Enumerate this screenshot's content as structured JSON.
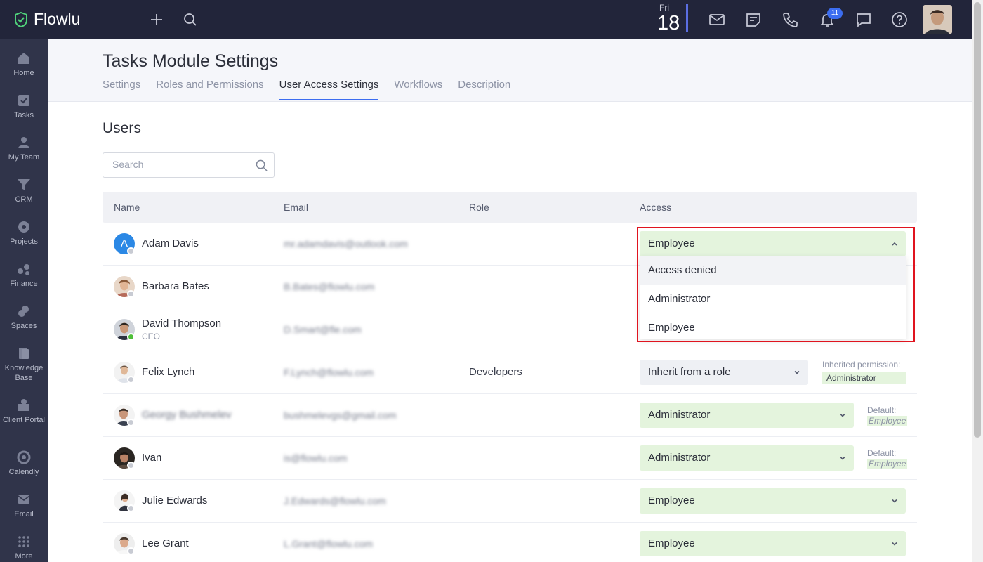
{
  "app": {
    "name": "Flowlu"
  },
  "topbar": {
    "date_dow": "Fri",
    "date_day": "18",
    "notifications_count": "11"
  },
  "sidebar": {
    "items": [
      {
        "label": "Home",
        "icon": "home-icon"
      },
      {
        "label": "Tasks",
        "icon": "tasks-icon"
      },
      {
        "label": "My Team",
        "icon": "team-icon"
      },
      {
        "label": "CRM",
        "icon": "crm-icon"
      },
      {
        "label": "Projects",
        "icon": "projects-icon"
      },
      {
        "label": "Finance",
        "icon": "finance-icon"
      },
      {
        "label": "Spaces",
        "icon": "spaces-icon"
      },
      {
        "label": "Knowledge Base",
        "icon": "knowledge-base-icon"
      },
      {
        "label": "Client Portal",
        "icon": "client-portal-icon"
      },
      {
        "label": "Calendly",
        "icon": "calendly-icon"
      },
      {
        "label": "Email",
        "icon": "email-icon"
      },
      {
        "label": "More",
        "icon": "more-icon"
      }
    ]
  },
  "page": {
    "title": "Tasks Module Settings",
    "tabs": [
      "Settings",
      "Roles and Permissions",
      "User Access Settings",
      "Workflows",
      "Description"
    ],
    "active_tab": "User Access Settings",
    "section_title": "Users",
    "search_placeholder": "Search"
  },
  "table": {
    "headers": {
      "name": "Name",
      "email": "Email",
      "role": "Role",
      "access": "Access"
    },
    "rows": [
      {
        "name": "Adam Davis",
        "sub": "",
        "email": "mr.adamdavis@outlook.com",
        "role": "",
        "access": "Employee"
      },
      {
        "name": "Barbara Bates",
        "sub": "",
        "email": "B.Bates@flowlu.com",
        "role": "",
        "access": ""
      },
      {
        "name": "David Thompson",
        "sub": "CEO",
        "email": "D.Smart@fle.com",
        "role": "",
        "access": ""
      },
      {
        "name": "Felix Lynch",
        "sub": "",
        "email": "F.Lynch@flowlu.com",
        "role": "Developers",
        "access": "Inherit from a role",
        "inherited_label": "Inherited permission:",
        "inherited_value": "Administrator"
      },
      {
        "name": "Georgy Bushmelev",
        "sub": "",
        "email": "bushmelevgs@gmail.com",
        "role": "",
        "access": "Administrator",
        "default_label": "Default:",
        "default_value": "Employee"
      },
      {
        "name": "Ivan",
        "sub": "",
        "email": "is@flowlu.com",
        "role": "",
        "access": "Administrator",
        "default_label": "Default:",
        "default_value": "Employee"
      },
      {
        "name": "Julie Edwards",
        "sub": "",
        "email": "J.Edwards@flowlu.com",
        "role": "",
        "access": "Employee"
      },
      {
        "name": "Lee Grant",
        "sub": "",
        "email": "L.Grant@flowlu.com",
        "role": "",
        "access": "Employee"
      }
    ]
  },
  "dropdown": {
    "options": [
      "Access denied",
      "Administrator",
      "Employee"
    ]
  },
  "colors": {
    "accent": "#3c6df0",
    "highlight": "#e0141f",
    "access_bg": "#e4f4dd"
  }
}
